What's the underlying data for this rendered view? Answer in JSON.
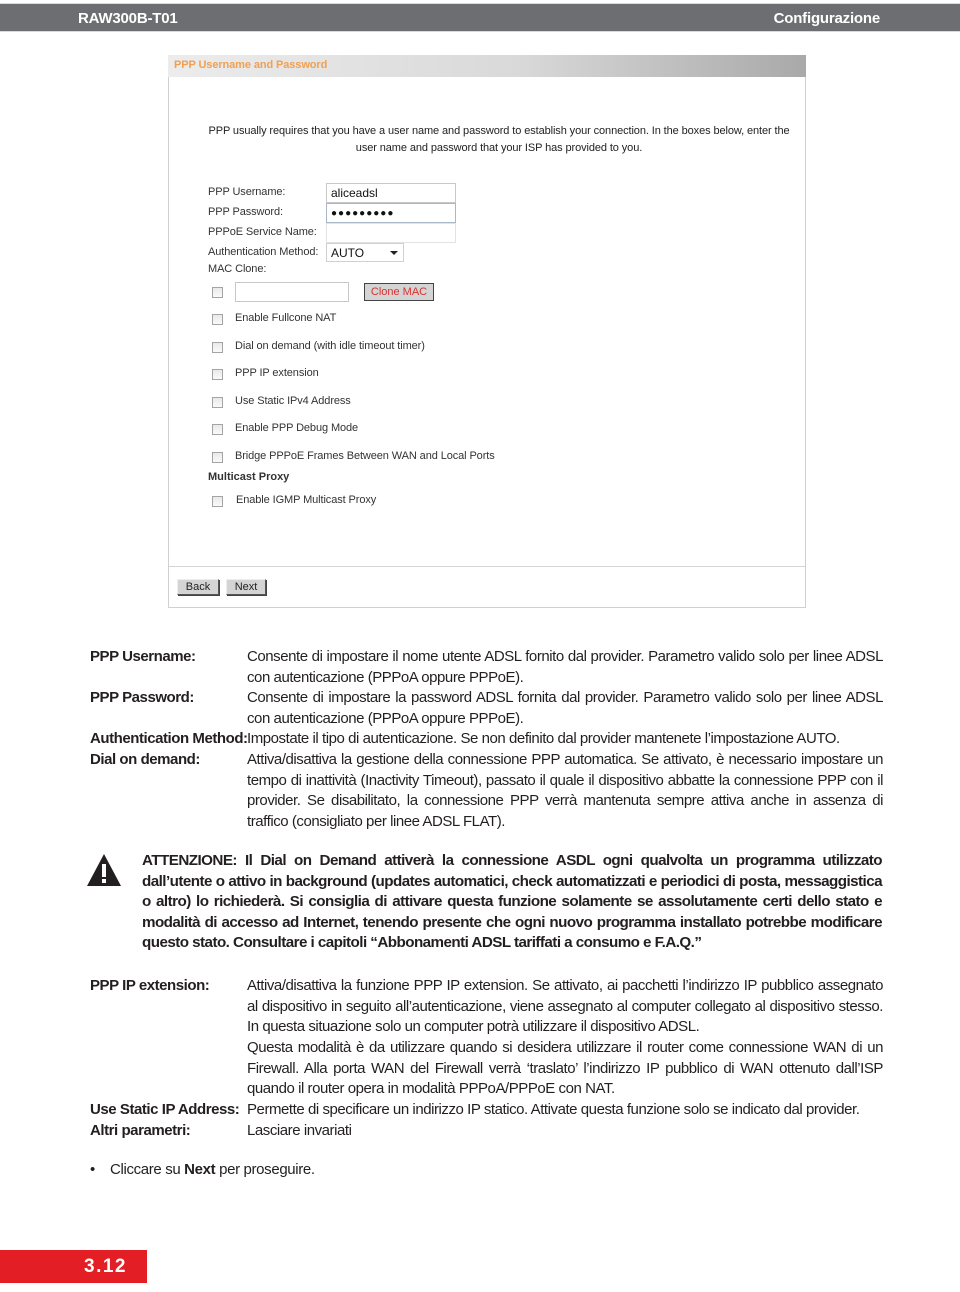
{
  "header": {
    "model": "RAW300B-T01",
    "section": "Configurazione"
  },
  "router_ui": {
    "panel_title": "PPP Username and Password",
    "intro": "PPP usually requires that you have a user name and password to establish your connection. In the boxes below, enter the user name and password that your ISP has provided to you.",
    "fields": {
      "username_label": "PPP Username:",
      "username_value": "aliceadsl",
      "password_label": "PPP Password:",
      "password_value": "●●●●●●●●●",
      "service_label": "PPPoE Service Name:",
      "service_value": "",
      "auth_label": "Authentication Method:",
      "auth_value": "AUTO",
      "mac_label": "MAC Clone:",
      "mac_value": "",
      "clone_mac_button": "Clone MAC"
    },
    "options": [
      {
        "label": "Enable Fullcone NAT",
        "checked": false
      },
      {
        "label": "Dial on demand (with idle timeout timer)",
        "checked": false
      },
      {
        "label": "PPP IP extension",
        "checked": false
      },
      {
        "label": "Use Static IPv4 Address",
        "checked": false
      },
      {
        "label": "Enable PPP Debug Mode",
        "checked": false
      },
      {
        "label": "Bridge PPPoE Frames Between WAN and Local Ports",
        "checked": false
      }
    ],
    "multicast_heading": "Multicast Proxy",
    "multicast_option": {
      "label": "Enable IGMP Multicast Proxy",
      "checked": false
    },
    "mac_clone_checked": false,
    "buttons": {
      "back": "Back",
      "next": "Next"
    },
    "colors": {
      "title_orange": "#f0a050",
      "clone_mac_red": "#d6322f"
    }
  },
  "descriptions_top": [
    {
      "term": "PPP Username:",
      "definition": "Consente di impostare il nome utente ADSL fornito dal provider. Parametro valido solo per linee ADSL con autenticazione (PPPoA oppure PPPoE)."
    },
    {
      "term": "PPP Password:",
      "definition": "Consente di impostare la password ADSL fornita dal provider. Parametro valido solo per linee ADSL con autenticazione (PPPoA oppure PPPoE)."
    },
    {
      "term": "Authentication Method:",
      "definition": "Impostate il tipo di autenticazione. Se non definito dal provider mantenete l’impostazione AUTO."
    },
    {
      "term": "Dial on demand:",
      "definition": "Attiva/disattiva la gestione della connessione PPP automatica. Se attivato, è necessario impostare un tempo di inattività (Inactivity Timeout), passato il quale il dispositivo abbatte la connessione PPP con il provider. Se disabilitato, la connessione PPP verrà mantenuta sempre attiva anche in assenza di traffico (consigliato per linee ADSL FLAT)."
    }
  ],
  "warning": {
    "icon": "warning-triangle-icon",
    "text": "ATTENZIONE: Il Dial on Demand attiverà la connessione ASDL ogni qualvolta un programma utilizzato dall’utente o attivo in background (updates automatici, check automatizzati e periodici di posta, messaggistica o altro) lo richiederà. Si consiglia di attivare questa funzione solamente se assolutamente certi dello stato e modalità di accesso ad Internet, tenendo presente che ogni nuovo programma installato potrebbe modificare questo stato. Consultare i capitoli “Abbonamenti ADSL tariffati a consumo e F.A.Q.”"
  },
  "descriptions_bottom": [
    {
      "term": "PPP IP extension:",
      "definition": "Attiva/disattiva la funzione PPP IP extension. Se attivato, ai pacchetti l’indirizzo IP pubblico assegnato al dispositivo in seguito all’autenticazione, viene assegnato al computer collegato al dispositivo stesso. In questa situazione solo un computer potrà utilizzare il dispositivo ADSL.",
      "definition_2": "Questa modalità è da utilizzare quando si desidera utilizzare il router come connessione WAN di un Firewall. Alla porta WAN del Firewall verrà ‘traslato’ l’indirizzo IP pubblico di WAN ottenuto dall’ISP quando il router opera in modalità PPPoA/PPPoE con NAT."
    },
    {
      "term": "Use Static IP Address:",
      "definition": "Permette di specificare un indirizzo IP statico. Attivate questa funzione solo se indicato dal provider."
    },
    {
      "term": "Altri parametri:",
      "definition": "Lasciare invariati"
    }
  ],
  "bullet": {
    "symbol": "•",
    "prefix": "Cliccare su ",
    "bold": "Next",
    "suffix": " per proseguire."
  },
  "page_number": "3.12",
  "colors": {
    "header_gray": "#6d6e71",
    "page_tab_red": "#e31e24"
  }
}
